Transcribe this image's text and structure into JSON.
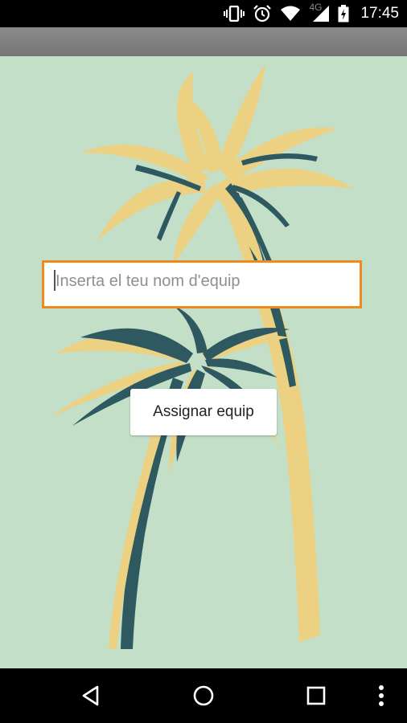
{
  "status_bar": {
    "time": "17:45",
    "network": "4G",
    "icons": [
      "vibrate-icon",
      "alarm-icon",
      "wifi-icon",
      "signal-icon",
      "battery-charging-icon"
    ]
  },
  "form": {
    "team_name_placeholder": "Inserta el teu nom d'equip",
    "team_name_value": "",
    "assign_button_label": "Assignar equip"
  },
  "colors": {
    "background": "#c3dfc7",
    "palm_dark": "#2e5960",
    "palm_light": "#ecd183",
    "input_focus_border": "#f08a1c"
  },
  "navigation": {
    "icons": [
      "back-icon",
      "home-icon",
      "recents-icon",
      "more-icon"
    ]
  }
}
